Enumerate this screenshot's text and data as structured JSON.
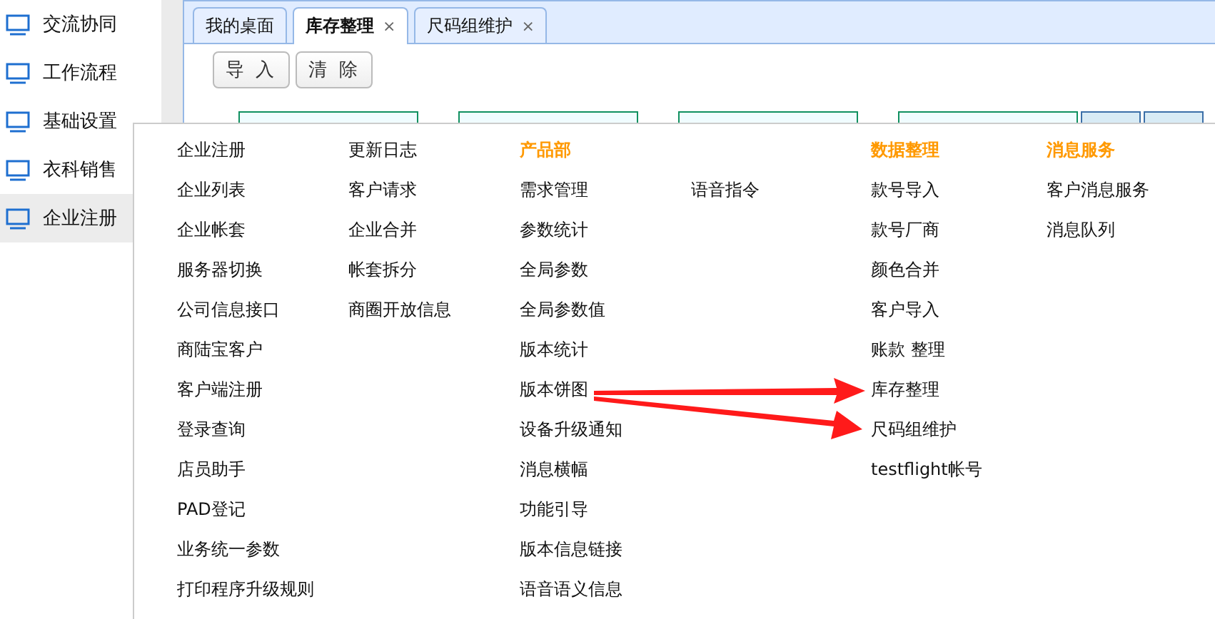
{
  "sidebar": {
    "items": [
      {
        "label": "交流协同",
        "selected": false
      },
      {
        "label": "工作流程",
        "selected": false
      },
      {
        "label": "基础设置",
        "selected": false
      },
      {
        "label": "衣科销售",
        "selected": false
      },
      {
        "label": "企业注册",
        "selected": true
      }
    ]
  },
  "tabs": [
    {
      "label": "我的桌面",
      "selected": false
    },
    {
      "label": "库存整理",
      "selected": true,
      "close": "×"
    },
    {
      "label": "尺码组维护",
      "selected": false,
      "close": "×"
    }
  ],
  "toolbar": {
    "buttons": [
      "导 入",
      "清 除"
    ]
  },
  "menu": {
    "columns": [
      {
        "kind": "plain",
        "items": [
          "企业注册",
          "企业列表",
          "企业帐套",
          "服务器切换",
          "公司信息接口",
          "商陆宝客户",
          "客户端注册",
          "登录查询",
          "店员助手",
          "PAD登记",
          "业务统一参数",
          "打印程序升级规则"
        ]
      },
      {
        "kind": "plain",
        "items": [
          "更新日志",
          "客户请求",
          "企业合并",
          "帐套拆分",
          "商圈开放信息"
        ]
      },
      {
        "kind": "group",
        "header": "产品部",
        "items": [
          "需求管理",
          "参数统计",
          "全局参数",
          "全局参数值",
          "版本统计",
          "版本饼图",
          "设备升级通知",
          "消息横幅",
          "功能引导",
          "版本信息链接",
          "语音语义信息"
        ]
      },
      {
        "kind": "group",
        "items": [
          "语音指令"
        ]
      },
      {
        "kind": "group",
        "header": "数据整理",
        "items": [
          "款号导入",
          "款号厂商",
          "颜色合并",
          "客户导入",
          "账款 整理",
          "库存整理",
          "尺码组维护",
          "testflight帐号"
        ]
      },
      {
        "kind": "group",
        "header": "消息服务",
        "items": [
          "客户消息服务",
          "消息队列"
        ]
      }
    ]
  }
}
